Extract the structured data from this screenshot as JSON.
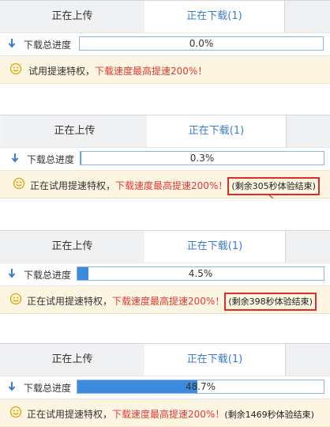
{
  "tabs": {
    "upload": "正在上传",
    "download": "正在下载(1)"
  },
  "progress_label": "下载总进度",
  "panels": [
    {
      "progress": 0.0,
      "progress_text": "0.0%",
      "notice_prefix": "试用提速特权，",
      "notice_red": "下载速度最高提速200%！",
      "remaining": ""
    },
    {
      "progress": 0.3,
      "progress_text": "0.3%",
      "notice_prefix": "正在试用提速特权，",
      "notice_red": "下载速度最高提速200%！",
      "remaining": "(剩余305秒体验结束)"
    },
    {
      "progress": 4.5,
      "progress_text": "4.5%",
      "notice_prefix": "正在试用提速特权，",
      "notice_red": "下载速度最高提速200%！",
      "remaining": "(剩余398秒体验结束)"
    },
    {
      "progress": 48.7,
      "progress_text": "48.7%",
      "notice_prefix": "正在试用提速特权，",
      "notice_red": "下载速度最高提速200%！",
      "remaining": "(剩余1469秒体验结束)"
    }
  ],
  "colors": {
    "tab_active_text": "#3a7bd5",
    "notice_red": "#e53935",
    "progress_fill": "#3c8bdc",
    "highlight_box": "#e02b2b",
    "notice_bg": "#fbf5e1"
  }
}
